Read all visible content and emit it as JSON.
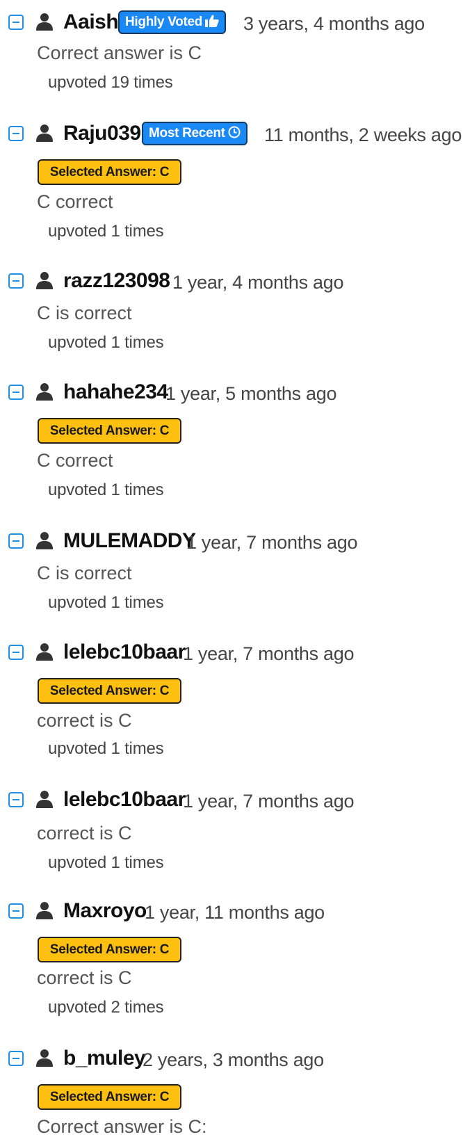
{
  "comments": [
    {
      "username": "Aaish",
      "badge": "Highly Voted",
      "badge_icon": "thumbs-up-icon",
      "time": "3 years, 4 months ago",
      "selected_answer": null,
      "text": "Correct answer is C",
      "upvotes": "upvoted 19 times"
    },
    {
      "username": "Raju039",
      "badge": "Most Recent",
      "badge_icon": "clock-icon",
      "time": "11 months, 2 weeks ago",
      "selected_answer": "Selected Answer: C",
      "text": "C correct",
      "upvotes": "upvoted 1 times"
    },
    {
      "username": "razz123098",
      "badge": null,
      "time": "1 year, 4 months ago",
      "selected_answer": null,
      "text": "C is correct",
      "upvotes": "upvoted 1 times"
    },
    {
      "username": "hahahe234",
      "badge": null,
      "time": "1 year, 5 months ago",
      "selected_answer": "Selected Answer: C",
      "text": "C correct",
      "upvotes": "upvoted 1 times"
    },
    {
      "username": "MULEMADDY",
      "badge": null,
      "time": "1 year, 7 months ago",
      "selected_answer": null,
      "text": "C is correct",
      "upvotes": "upvoted 1 times"
    },
    {
      "username": "lelebc10baar",
      "badge": null,
      "time": "1 year, 7 months ago",
      "selected_answer": "Selected Answer: C",
      "text": "correct is C",
      "upvotes": "upvoted 1 times"
    },
    {
      "username": "lelebc10baar",
      "badge": null,
      "time": "1 year, 7 months ago",
      "selected_answer": null,
      "text": "correct is C",
      "upvotes": "upvoted 1 times"
    },
    {
      "username": "Maxroyo",
      "badge": null,
      "time": "1 year, 11 months ago",
      "selected_answer": "Selected Answer: C",
      "text": "correct is C",
      "upvotes": "upvoted 2 times"
    },
    {
      "username": "b_muley",
      "badge": null,
      "time": "2 years, 3 months ago",
      "selected_answer": "Selected Answer: C",
      "text": "Correct answer is C:",
      "upvotes": null
    }
  ],
  "colors": {
    "accent_blue": "#1a88f5",
    "collapse_blue": "#1e90e6",
    "selected_yellow": "#fdbf10"
  }
}
